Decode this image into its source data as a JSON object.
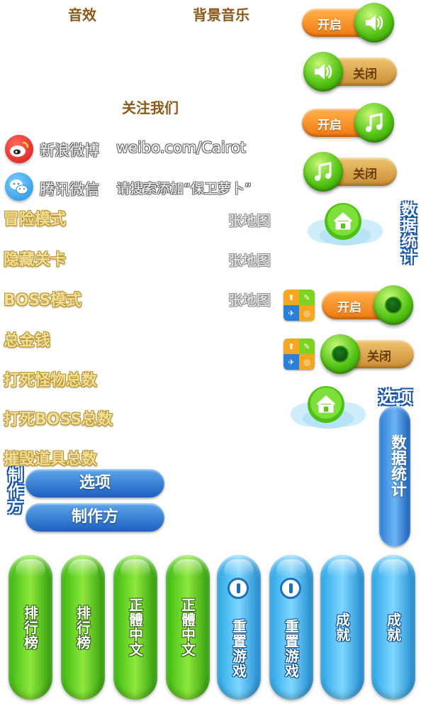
{
  "audio": {
    "sound_effects_label": "音效",
    "music_label": "背景音乐"
  },
  "toggles": [
    {
      "state": "开启",
      "icon": "speaker-icon"
    },
    {
      "state": "关闭",
      "icon": "speaker-icon"
    },
    {
      "state": "开启",
      "icon": "music-note-icon"
    },
    {
      "state": "关闭",
      "icon": "music-note-icon"
    }
  ],
  "follow": {
    "title": "关注我们",
    "weibo_label": "新浪微博",
    "weibo_handle": "weibo.com/Cairot",
    "wechat_label": "腾讯微信",
    "wechat_hint": "请搜索添加“保卫萝卜”"
  },
  "stats": {
    "adventure_mode": "冒险模式",
    "hidden_levels": "隐藏关卡",
    "boss_mode": "BOSS模式",
    "maps_suffix": "张地图",
    "total_money": "总金钱",
    "monsters_killed": "打死怪物总数",
    "bosses_killed": "打死BOSS总数",
    "props_destroyed": "摧毁道具总数"
  },
  "side_titles": {
    "statistics": "数据统计",
    "options": "选项",
    "credits": "制作方"
  },
  "extra_toggles": [
    {
      "state": "开启"
    },
    {
      "state": "关闭"
    }
  ],
  "menu_buttons": {
    "options": "选项",
    "credits": "制作方",
    "statistics": "数据统计"
  },
  "capsules": [
    {
      "label": "排行榜",
      "color": "green"
    },
    {
      "label": "排行榜",
      "color": "green"
    },
    {
      "label": "正體中文",
      "color": "green"
    },
    {
      "label": "正體中文",
      "color": "green"
    },
    {
      "label": "重置游戏",
      "color": "blue",
      "icon": "info-icon"
    },
    {
      "label": "重置游戏",
      "color": "blue",
      "icon": "info-icon"
    },
    {
      "label": "成就",
      "color": "blue"
    },
    {
      "label": "成就",
      "color": "blue"
    }
  ],
  "colors": {
    "toggle_on": "#f07a10",
    "toggle_off": "#c98d34",
    "knob_green": "#54c414",
    "menu_blue": "#1c60c0",
    "capsule_green": "#5ccf20",
    "capsule_blue": "#3ab4f0",
    "gold_text": "#f0df98"
  }
}
